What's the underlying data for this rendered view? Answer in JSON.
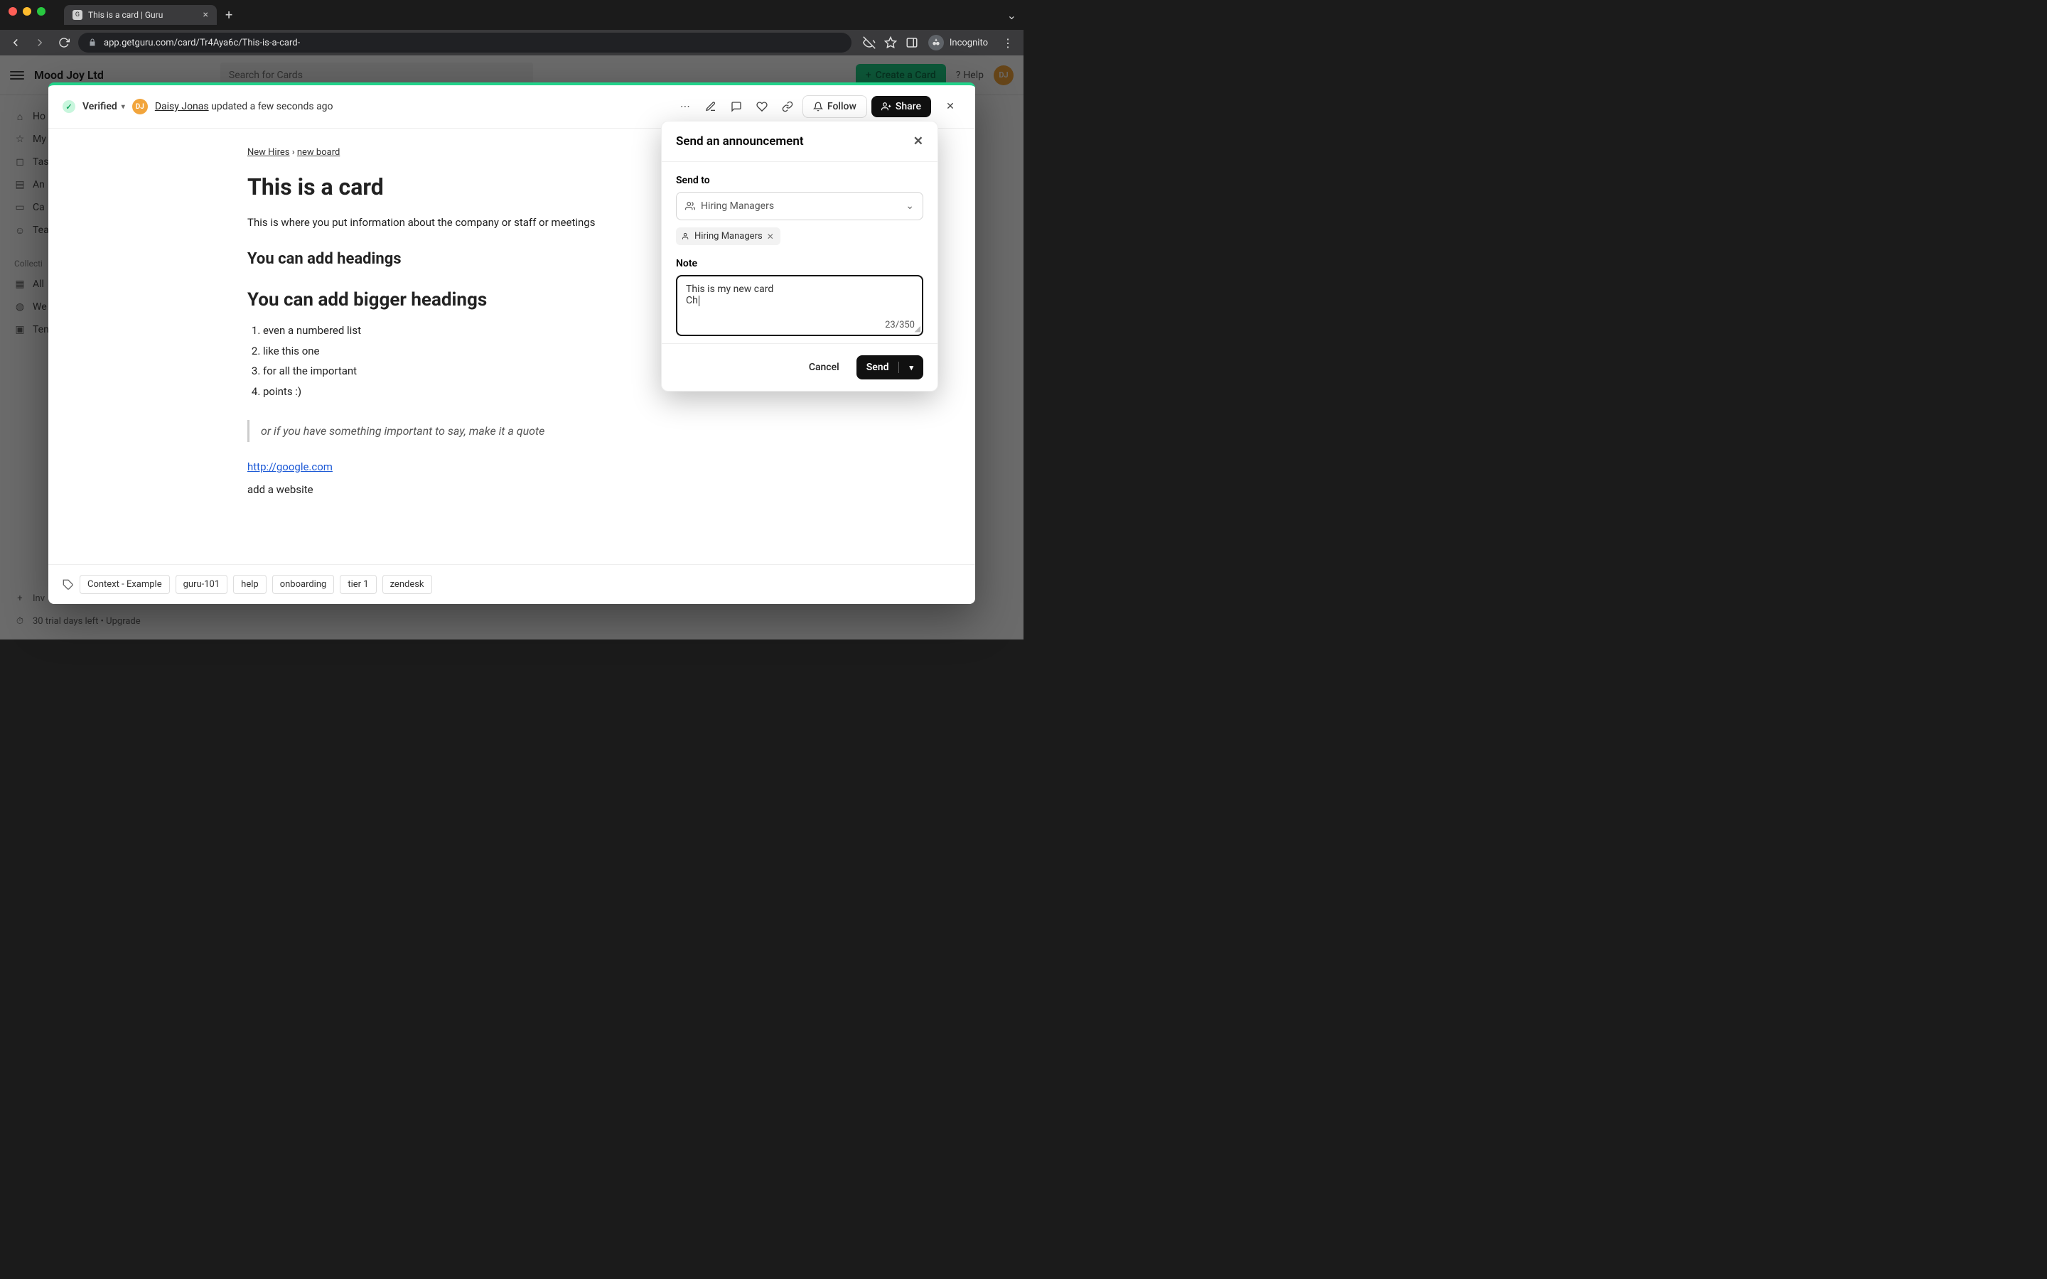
{
  "browser": {
    "tab_title": "This is a card | Guru",
    "url": "app.getguru.com/card/Tr4Aya6c/This-is-a-card-",
    "incognito_label": "Incognito"
  },
  "app_header": {
    "brand": "Mood Joy Ltd",
    "search_placeholder": "Search for Cards",
    "create_label": "Create a Card",
    "help_label": "Help",
    "avatar_initials": "DJ"
  },
  "sidebar": {
    "items": [
      {
        "icon": "home-icon",
        "label": "Ho"
      },
      {
        "icon": "bookmark-icon",
        "label": "My"
      },
      {
        "icon": "bell-icon",
        "label": "Tas"
      },
      {
        "icon": "chart-icon",
        "label": "An"
      },
      {
        "icon": "card-icon",
        "label": "Ca"
      },
      {
        "icon": "people-icon",
        "label": "Tea"
      }
    ],
    "section_label": "Collecti",
    "collections": [
      {
        "icon": "grid-icon",
        "label": "All"
      },
      {
        "icon": "globe-icon",
        "label": "We"
      },
      {
        "icon": "template-icon",
        "label": "Ten"
      }
    ],
    "invite_label": "Inv",
    "trial_label": "30 trial days left • Upgrade"
  },
  "card": {
    "verified_label": "Verified",
    "author_initials": "DJ",
    "author_name": "Daisy Jonas",
    "updated_text": "updated a few seconds ago",
    "follow_label": "Follow",
    "share_label": "Share",
    "breadcrumbs": {
      "parent": "New Hires",
      "child": "new board"
    },
    "title": "This is a card",
    "intro": "This is where you put information about the company or staff or meetings",
    "heading_small": "You can add headings",
    "heading_big": "You can add bigger headings",
    "list": [
      "even a numbered list",
      "like this one",
      "for all the important",
      "points :)"
    ],
    "quote": "or if you have something important to say, make it a quote",
    "link_text": "http://google.com",
    "link_caption": "add a website",
    "tags": [
      "Context - Example",
      "guru-101",
      "help",
      "onboarding",
      "tier 1",
      "zendesk"
    ]
  },
  "popover": {
    "title": "Send an announcement",
    "send_to_label": "Send to",
    "select_placeholder": "Hiring Managers",
    "chips": [
      "Hiring Managers"
    ],
    "note_label": "Note",
    "note_value": "This is my new card\nCh",
    "counter": "23/350",
    "cancel_label": "Cancel",
    "send_label": "Send"
  },
  "colors": {
    "traffic_red": "#ff5f57",
    "traffic_yellow": "#febc2e",
    "traffic_green": "#28c840"
  }
}
